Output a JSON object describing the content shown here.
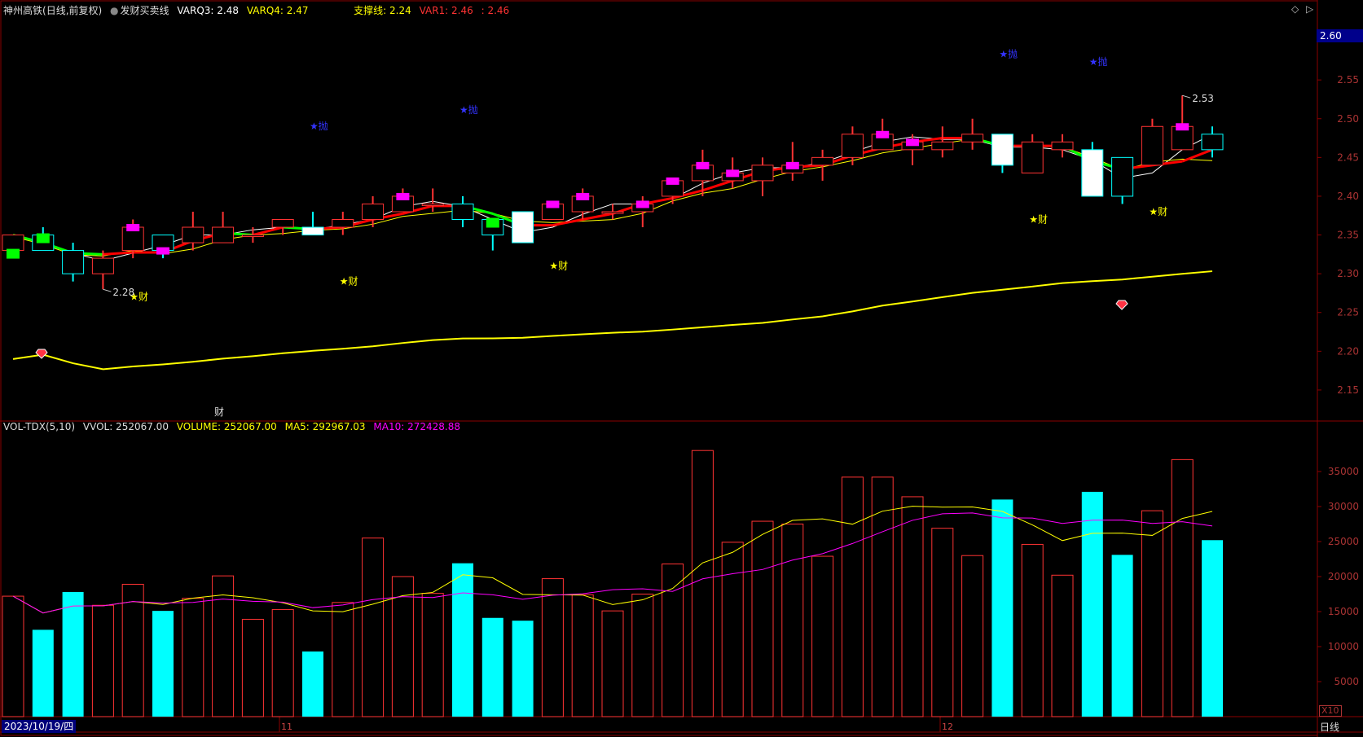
{
  "header": {
    "title": "神州高铁",
    "mode": "(日线,前复权)",
    "indicator": "发财买卖线",
    "varq3": "VARQ3: 2.48",
    "varq4": "VARQ4: 2.47",
    "support": "支撑线: 2.24",
    "var1": "VAR1: 2.46",
    "var2": ": 2.46"
  },
  "vol_header": {
    "name": "VOL-TDX(5,10)",
    "vvol": "VVOL: 252067.00",
    "volume": "VOLUME: 252067.00",
    "ma5": "MA5: 292967.03",
    "ma10": "MA10: 272428.88"
  },
  "price_box": "2.60",
  "price_axis": [
    "2.55",
    "2.50",
    "2.45",
    "2.40",
    "2.35",
    "2.30",
    "2.25",
    "2.20",
    "2.15"
  ],
  "vol_axis": [
    "35000",
    "30000",
    "25000",
    "20000",
    "15000",
    "10000",
    "5000"
  ],
  "vol_unit": "X10",
  "date_box": "2023/10/19/四",
  "period_label": "日线",
  "month_labels": [
    "11",
    "12"
  ],
  "annotations": {
    "low_label": "2.28",
    "high_label": "2.53",
    "cai": "★财",
    "pao": "★抛",
    "cai_bottom": "财"
  },
  "colors": {
    "up": "#ff3333",
    "down": "#00ffff",
    "ma_up": "#ff0000",
    "ma_down": "#00ff00",
    "support_line": "#ffff00",
    "vol_ma5": "#ffff00",
    "vol_ma10": "#ff00ff",
    "grid": "#8b0000"
  },
  "chart_data": {
    "type": "candlestick",
    "candles": [
      {
        "o": 2.33,
        "h": 2.35,
        "l": 2.32,
        "c": 2.35,
        "v": 17200
      },
      {
        "o": 2.35,
        "h": 2.36,
        "l": 2.33,
        "c": 2.33,
        "v": 12400
      },
      {
        "o": 2.33,
        "h": 2.34,
        "l": 2.29,
        "c": 2.3,
        "v": 17800
      },
      {
        "o": 2.3,
        "h": 2.33,
        "l": 2.28,
        "c": 2.32,
        "v": 15900
      },
      {
        "o": 2.33,
        "h": 2.37,
        "l": 2.32,
        "c": 2.36,
        "v": 18900
      },
      {
        "o": 2.35,
        "h": 2.35,
        "l": 2.32,
        "c": 2.33,
        "v": 15100
      },
      {
        "o": 2.34,
        "h": 2.38,
        "l": 2.33,
        "c": 2.36,
        "v": 16900
      },
      {
        "o": 2.34,
        "h": 2.38,
        "l": 2.34,
        "c": 2.36,
        "v": 20100
      },
      {
        "o": 2.35,
        "h": 2.36,
        "l": 2.34,
        "c": 2.35,
        "v": 13900
      },
      {
        "o": 2.36,
        "h": 2.37,
        "l": 2.35,
        "c": 2.37,
        "v": 15300
      },
      {
        "o": 2.36,
        "h": 2.38,
        "l": 2.35,
        "c": 2.35,
        "v": 9300
      },
      {
        "o": 2.36,
        "h": 2.38,
        "l": 2.35,
        "c": 2.37,
        "v": 16300
      },
      {
        "o": 2.37,
        "h": 2.4,
        "l": 2.36,
        "c": 2.39,
        "v": 25500
      },
      {
        "o": 2.38,
        "h": 2.41,
        "l": 2.38,
        "c": 2.4,
        "v": 20000
      },
      {
        "o": 2.39,
        "h": 2.41,
        "l": 2.38,
        "c": 2.39,
        "v": 17600
      },
      {
        "o": 2.39,
        "h": 2.4,
        "l": 2.36,
        "c": 2.37,
        "v": 21900
      },
      {
        "o": 2.37,
        "h": 2.37,
        "l": 2.33,
        "c": 2.35,
        "v": 14100
      },
      {
        "o": 2.38,
        "h": 2.38,
        "l": 2.34,
        "c": 2.34,
        "v": 13700
      },
      {
        "o": 2.37,
        "h": 2.39,
        "l": 2.37,
        "c": 2.39,
        "v": 19700
      },
      {
        "o": 2.38,
        "h": 2.41,
        "l": 2.37,
        "c": 2.4,
        "v": 17400
      },
      {
        "o": 2.38,
        "h": 2.39,
        "l": 2.37,
        "c": 2.38,
        "v": 15100
      },
      {
        "o": 2.38,
        "h": 2.4,
        "l": 2.36,
        "c": 2.39,
        "v": 17500
      },
      {
        "o": 2.4,
        "h": 2.42,
        "l": 2.39,
        "c": 2.42,
        "v": 21800
      },
      {
        "o": 2.42,
        "h": 2.46,
        "l": 2.4,
        "c": 2.44,
        "v": 38000
      },
      {
        "o": 2.42,
        "h": 2.45,
        "l": 2.41,
        "c": 2.43,
        "v": 24900
      },
      {
        "o": 2.42,
        "h": 2.45,
        "l": 2.4,
        "c": 2.44,
        "v": 27900
      },
      {
        "o": 2.43,
        "h": 2.47,
        "l": 2.42,
        "c": 2.44,
        "v": 27500
      },
      {
        "o": 2.44,
        "h": 2.46,
        "l": 2.42,
        "c": 2.45,
        "v": 22900
      },
      {
        "o": 2.45,
        "h": 2.49,
        "l": 2.44,
        "c": 2.48,
        "v": 34200
      },
      {
        "o": 2.46,
        "h": 2.5,
        "l": 2.46,
        "c": 2.48,
        "v": 34200
      },
      {
        "o": 2.46,
        "h": 2.48,
        "l": 2.44,
        "c": 2.47,
        "v": 31400
      },
      {
        "o": 2.46,
        "h": 2.49,
        "l": 2.45,
        "c": 2.47,
        "v": 26900
      },
      {
        "o": 2.47,
        "h": 2.5,
        "l": 2.46,
        "c": 2.48,
        "v": 23000
      },
      {
        "o": 2.48,
        "h": 2.48,
        "l": 2.43,
        "c": 2.44,
        "v": 31000
      },
      {
        "o": 2.43,
        "h": 2.48,
        "l": 2.43,
        "c": 2.47,
        "v": 24600
      },
      {
        "o": 2.46,
        "h": 2.48,
        "l": 2.45,
        "c": 2.47,
        "v": 20200
      },
      {
        "o": 2.46,
        "h": 2.47,
        "l": 2.4,
        "c": 2.4,
        "v": 32100
      },
      {
        "o": 2.45,
        "h": 2.45,
        "l": 2.39,
        "c": 2.4,
        "v": 23100
      },
      {
        "o": 2.44,
        "h": 2.5,
        "l": 2.44,
        "c": 2.49,
        "v": 29400
      },
      {
        "o": 2.46,
        "h": 2.53,
        "l": 2.46,
        "c": 2.49,
        "v": 36700
      },
      {
        "o": 2.48,
        "h": 2.49,
        "l": 2.45,
        "c": 2.46,
        "v": 25200
      }
    ],
    "ylim": [
      2.11,
      2.63
    ],
    "vol_ylim": [
      0,
      40000
    ]
  }
}
